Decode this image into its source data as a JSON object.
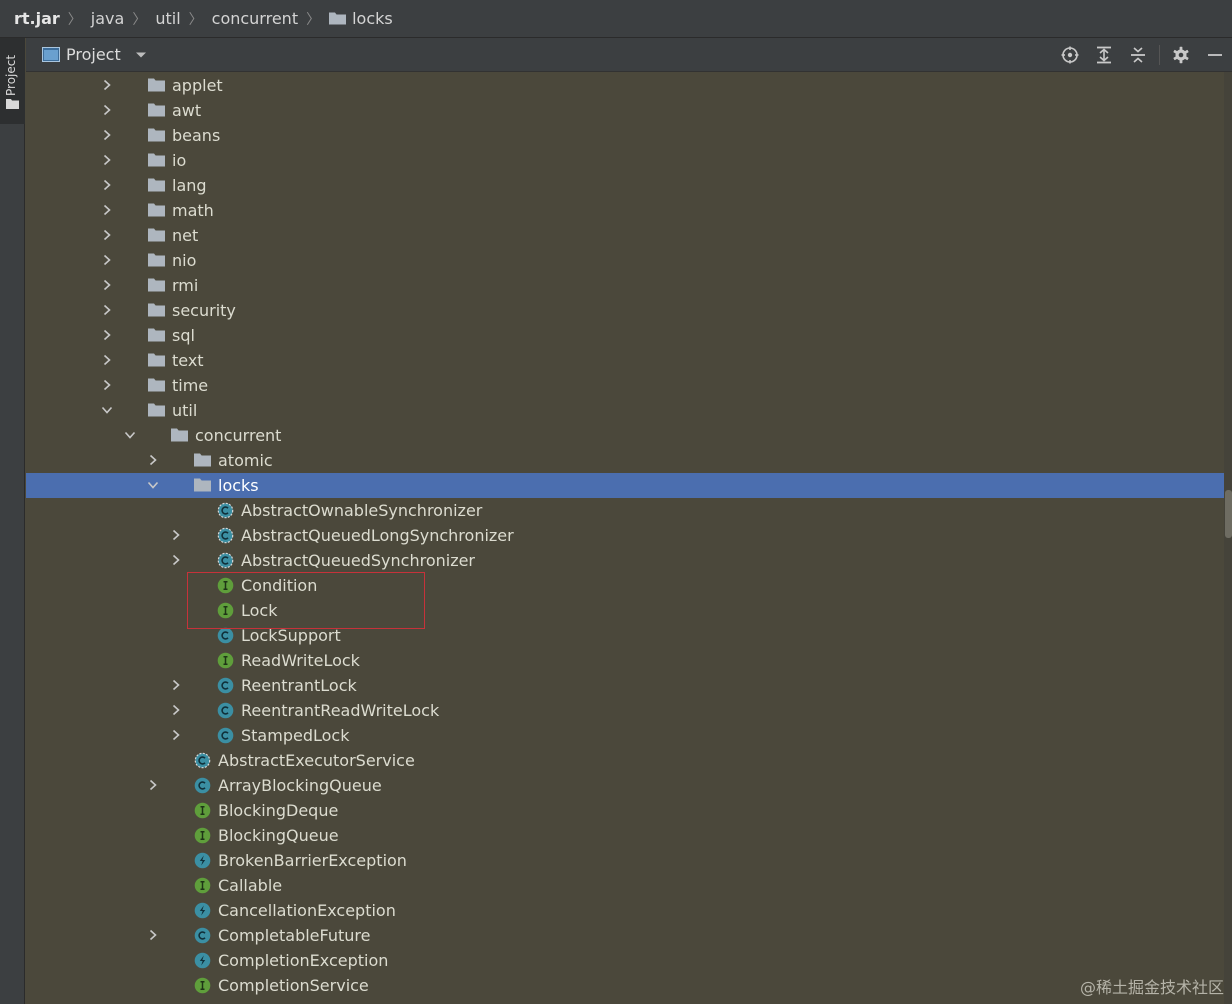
{
  "breadcrumb": [
    "rt.jar",
    "java",
    "util",
    "concurrent",
    "locks"
  ],
  "side_tab": {
    "label": "Project"
  },
  "tool_window": {
    "title": "Project",
    "actions": [
      "locate-icon",
      "expand-all-icon",
      "collapse-all-icon",
      "gear-icon",
      "minimize-icon"
    ]
  },
  "colors": {
    "background": "#4b483b",
    "selection": "#4b6eaf",
    "interface_icon": "#5f9e3b",
    "class_icon": "#3b8fa3",
    "highlight_box": "#c6323a"
  },
  "tree": [
    {
      "label": "applet",
      "depth": 0,
      "kind": "folder",
      "arrow": "collapsed"
    },
    {
      "label": "awt",
      "depth": 0,
      "kind": "folder",
      "arrow": "collapsed"
    },
    {
      "label": "beans",
      "depth": 0,
      "kind": "folder",
      "arrow": "collapsed"
    },
    {
      "label": "io",
      "depth": 0,
      "kind": "folder",
      "arrow": "collapsed"
    },
    {
      "label": "lang",
      "depth": 0,
      "kind": "folder",
      "arrow": "collapsed"
    },
    {
      "label": "math",
      "depth": 0,
      "kind": "folder",
      "arrow": "collapsed"
    },
    {
      "label": "net",
      "depth": 0,
      "kind": "folder",
      "arrow": "collapsed"
    },
    {
      "label": "nio",
      "depth": 0,
      "kind": "folder",
      "arrow": "collapsed"
    },
    {
      "label": "rmi",
      "depth": 0,
      "kind": "folder",
      "arrow": "collapsed"
    },
    {
      "label": "security",
      "depth": 0,
      "kind": "folder",
      "arrow": "collapsed"
    },
    {
      "label": "sql",
      "depth": 0,
      "kind": "folder",
      "arrow": "collapsed"
    },
    {
      "label": "text",
      "depth": 0,
      "kind": "folder",
      "arrow": "collapsed"
    },
    {
      "label": "time",
      "depth": 0,
      "kind": "folder",
      "arrow": "collapsed"
    },
    {
      "label": "util",
      "depth": 0,
      "kind": "folder",
      "arrow": "expanded"
    },
    {
      "label": "concurrent",
      "depth": 1,
      "kind": "folder",
      "arrow": "expanded"
    },
    {
      "label": "atomic",
      "depth": 2,
      "kind": "folder",
      "arrow": "collapsed"
    },
    {
      "label": "locks",
      "depth": 2,
      "kind": "folder",
      "arrow": "expanded",
      "selected": true
    },
    {
      "label": "AbstractOwnableSynchronizer",
      "depth": 3,
      "kind": "abstract-class",
      "arrow": "none"
    },
    {
      "label": "AbstractQueuedLongSynchronizer",
      "depth": 3,
      "kind": "abstract-class",
      "arrow": "collapsed"
    },
    {
      "label": "AbstractQueuedSynchronizer",
      "depth": 3,
      "kind": "abstract-class",
      "arrow": "collapsed"
    },
    {
      "label": "Condition",
      "depth": 3,
      "kind": "interface",
      "arrow": "none"
    },
    {
      "label": "Lock",
      "depth": 3,
      "kind": "interface",
      "arrow": "none"
    },
    {
      "label": "LockSupport",
      "depth": 3,
      "kind": "class",
      "arrow": "none"
    },
    {
      "label": "ReadWriteLock",
      "depth": 3,
      "kind": "interface",
      "arrow": "none"
    },
    {
      "label": "ReentrantLock",
      "depth": 3,
      "kind": "class",
      "arrow": "collapsed"
    },
    {
      "label": "ReentrantReadWriteLock",
      "depth": 3,
      "kind": "class",
      "arrow": "collapsed"
    },
    {
      "label": "StampedLock",
      "depth": 3,
      "kind": "class",
      "arrow": "collapsed"
    },
    {
      "label": "AbstractExecutorService",
      "depth": 2,
      "kind": "abstract-class",
      "arrow": "none"
    },
    {
      "label": "ArrayBlockingQueue",
      "depth": 2,
      "kind": "class",
      "arrow": "collapsed"
    },
    {
      "label": "BlockingDeque",
      "depth": 2,
      "kind": "interface",
      "arrow": "none"
    },
    {
      "label": "BlockingQueue",
      "depth": 2,
      "kind": "interface",
      "arrow": "none"
    },
    {
      "label": "BrokenBarrierException",
      "depth": 2,
      "kind": "exception",
      "arrow": "none"
    },
    {
      "label": "Callable",
      "depth": 2,
      "kind": "interface",
      "arrow": "none"
    },
    {
      "label": "CancellationException",
      "depth": 2,
      "kind": "exception",
      "arrow": "none"
    },
    {
      "label": "CompletableFuture",
      "depth": 2,
      "kind": "class",
      "arrow": "collapsed"
    },
    {
      "label": "CompletionException",
      "depth": 2,
      "kind": "exception",
      "arrow": "none"
    },
    {
      "label": "CompletionService",
      "depth": 2,
      "kind": "interface",
      "arrow": "none"
    }
  ],
  "watermark": "@稀土掘金技术社区"
}
